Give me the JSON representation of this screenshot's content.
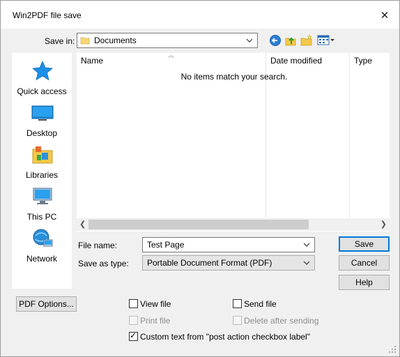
{
  "window": {
    "title": "Win2PDF file save",
    "close_symbol": "✕"
  },
  "save_in": {
    "label": "Save in:",
    "value": "Documents"
  },
  "places": [
    {
      "label": "Quick access",
      "icon": "quick-access-icon"
    },
    {
      "label": "Desktop",
      "icon": "desktop-icon"
    },
    {
      "label": "Libraries",
      "icon": "libraries-icon"
    },
    {
      "label": "This PC",
      "icon": "this-pc-icon"
    },
    {
      "label": "Network",
      "icon": "network-icon"
    }
  ],
  "file_list": {
    "columns": [
      "Name",
      "Date modified",
      "Type"
    ],
    "empty_message": "No items match your search."
  },
  "file_name": {
    "label": "File name:",
    "value": "Test Page"
  },
  "save_as_type": {
    "label": "Save as type:",
    "value": "Portable Document Format (PDF)"
  },
  "buttons": {
    "save": "Save",
    "cancel": "Cancel",
    "help": "Help",
    "pdf_options": "PDF Options..."
  },
  "options": {
    "view_file": {
      "label": "View file",
      "checked": false,
      "enabled": true
    },
    "send_file": {
      "label": "Send file",
      "checked": false,
      "enabled": true
    },
    "print_file": {
      "label": "Print file",
      "checked": false,
      "enabled": false
    },
    "delete_after_sending": {
      "label": "Delete after sending",
      "checked": false,
      "enabled": false
    },
    "custom_text": {
      "label": "Custom text from \"post action checkbox label\"",
      "checked": true,
      "enabled": true
    }
  },
  "colors": {
    "accent": "#0078d7",
    "window_bg": "#f0f0f0"
  }
}
